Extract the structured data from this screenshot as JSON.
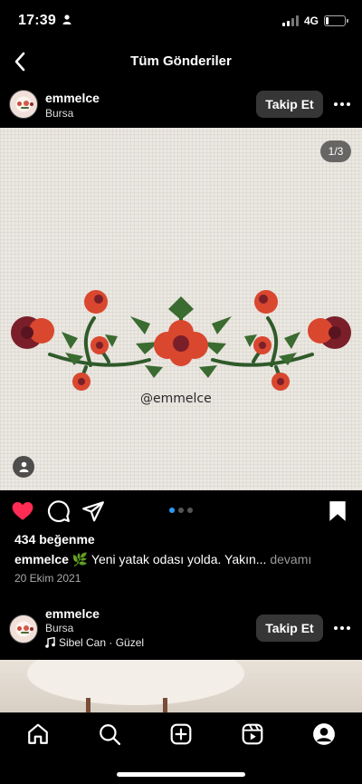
{
  "status_bar": {
    "time": "17:39",
    "network": "4G",
    "battery_level": 0.12
  },
  "header": {
    "title": "Tüm Gönderiler"
  },
  "post1": {
    "username": "emmelce",
    "location": "Bursa",
    "follow_label": "Takip Et",
    "image_counter": "1/3",
    "watermark": "@emmelce",
    "likes": "434 beğenme",
    "caption_user": "emmelce",
    "caption_emoji": "🌿",
    "caption_text": "Yeni yatak odası yolda. Yakın...",
    "caption_more": "devamı",
    "date": "20 Ekim 2021",
    "carousel_pages": 3,
    "carousel_active": 1
  },
  "post2": {
    "username": "emmelce",
    "location": "Bursa",
    "music": "Sibel Can · Güzel",
    "follow_label": "Takip Et"
  },
  "icons": {
    "like": "heart-filled-icon",
    "comment": "comment-icon",
    "share": "paper-plane-icon",
    "save": "bookmark-filled-icon"
  },
  "colors": {
    "like": "#fe2b54",
    "carousel_active": "#2b9bf4",
    "follow_bg": "#363636"
  }
}
